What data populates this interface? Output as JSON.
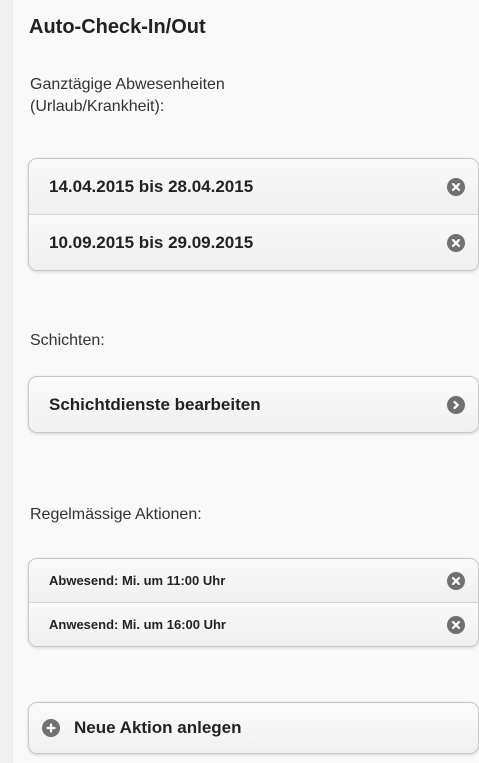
{
  "panel": {
    "title": "Auto-Check-In/Out"
  },
  "absences": {
    "label_line1": "Ganztägige Abwesenheiten",
    "label_line2": "(Urlaub/Krankheit):",
    "items": [
      {
        "label": "14.04.2015 bis 28.04.2015",
        "icon": "delete-icon"
      },
      {
        "label": "10.09.2015 bis 29.09.2015",
        "icon": "delete-icon"
      }
    ]
  },
  "shifts": {
    "label": "Schichten:",
    "button_label": "Schichtdienste bearbeiten",
    "button_icon": "chevron-right-icon"
  },
  "actions": {
    "label": "Regelmässige Aktionen:",
    "items": [
      {
        "label": "Abwesend: Mi. um 11:00 Uhr",
        "icon": "delete-icon"
      },
      {
        "label": "Anwesend: Mi. um 16:00 Uhr",
        "icon": "delete-icon"
      }
    ],
    "new_button_label": "Neue Aktion anlegen",
    "new_button_icon": "plus-icon"
  },
  "colors": {
    "icon_bg": "#707070",
    "page_bg": "#f9f9f9"
  }
}
